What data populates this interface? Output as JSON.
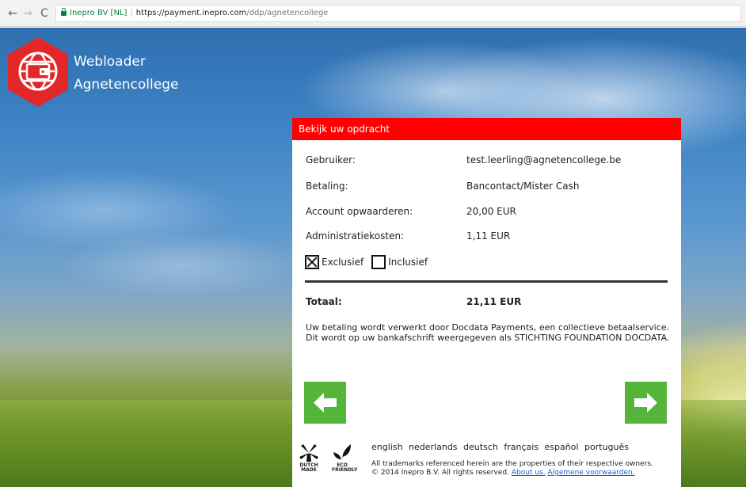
{
  "browser": {
    "secure_label": "Inepro BV [NL]",
    "url_host": "https://payment.inepro.com",
    "url_path": "/ddp/agnetencollege"
  },
  "logo": {
    "line1": "Webloader",
    "line2": "Agnetencollege",
    "icon": "globe-wallet-icon"
  },
  "panel": {
    "header": "Bekijk uw opdracht",
    "rows": [
      {
        "label": "Gebruiker:",
        "value": "test.leerling@agnetencollege.be"
      },
      {
        "label": "Betaling:",
        "value": "Bancontact/Mister Cash"
      },
      {
        "label": "Account opwaarderen:",
        "value": "20,00 EUR"
      },
      {
        "label": "Administratiekosten:",
        "value": "1,11 EUR"
      }
    ],
    "options": [
      {
        "label": "Exclusief",
        "checked": true
      },
      {
        "label": "Inclusief",
        "checked": false
      }
    ],
    "total_label": "Totaal:",
    "total_value": "21,11 EUR",
    "info": "Uw betaling wordt verwerkt door Docdata Payments, een collectieve betaalservice. Dit wordt op uw bankafschrift weergegeven als STICHTING FOUNDATION DOCDATA.",
    "back_icon": "arrow-left-icon",
    "next_icon": "arrow-right-icon"
  },
  "footer": {
    "badge1": {
      "line1": "DUTCH",
      "line2": "MADE"
    },
    "badge2": {
      "line1": "ECO",
      "line2": "FRIENDLY"
    },
    "languages": [
      "english",
      "nederlands",
      "deutsch",
      "français",
      "español",
      "português"
    ],
    "trademark": "All trademarks referenced herein are the properties of their respective owners.",
    "copyright": "© 2014 Inepro B.V. All rights reserved.",
    "link_about": "About us.",
    "link_terms": "Algemene voorwaarden."
  },
  "colors": {
    "accent_red": "#ff0000",
    "logo_red": "#e32728",
    "button_green": "#55b43a",
    "link_blue": "#1a5fc9"
  }
}
